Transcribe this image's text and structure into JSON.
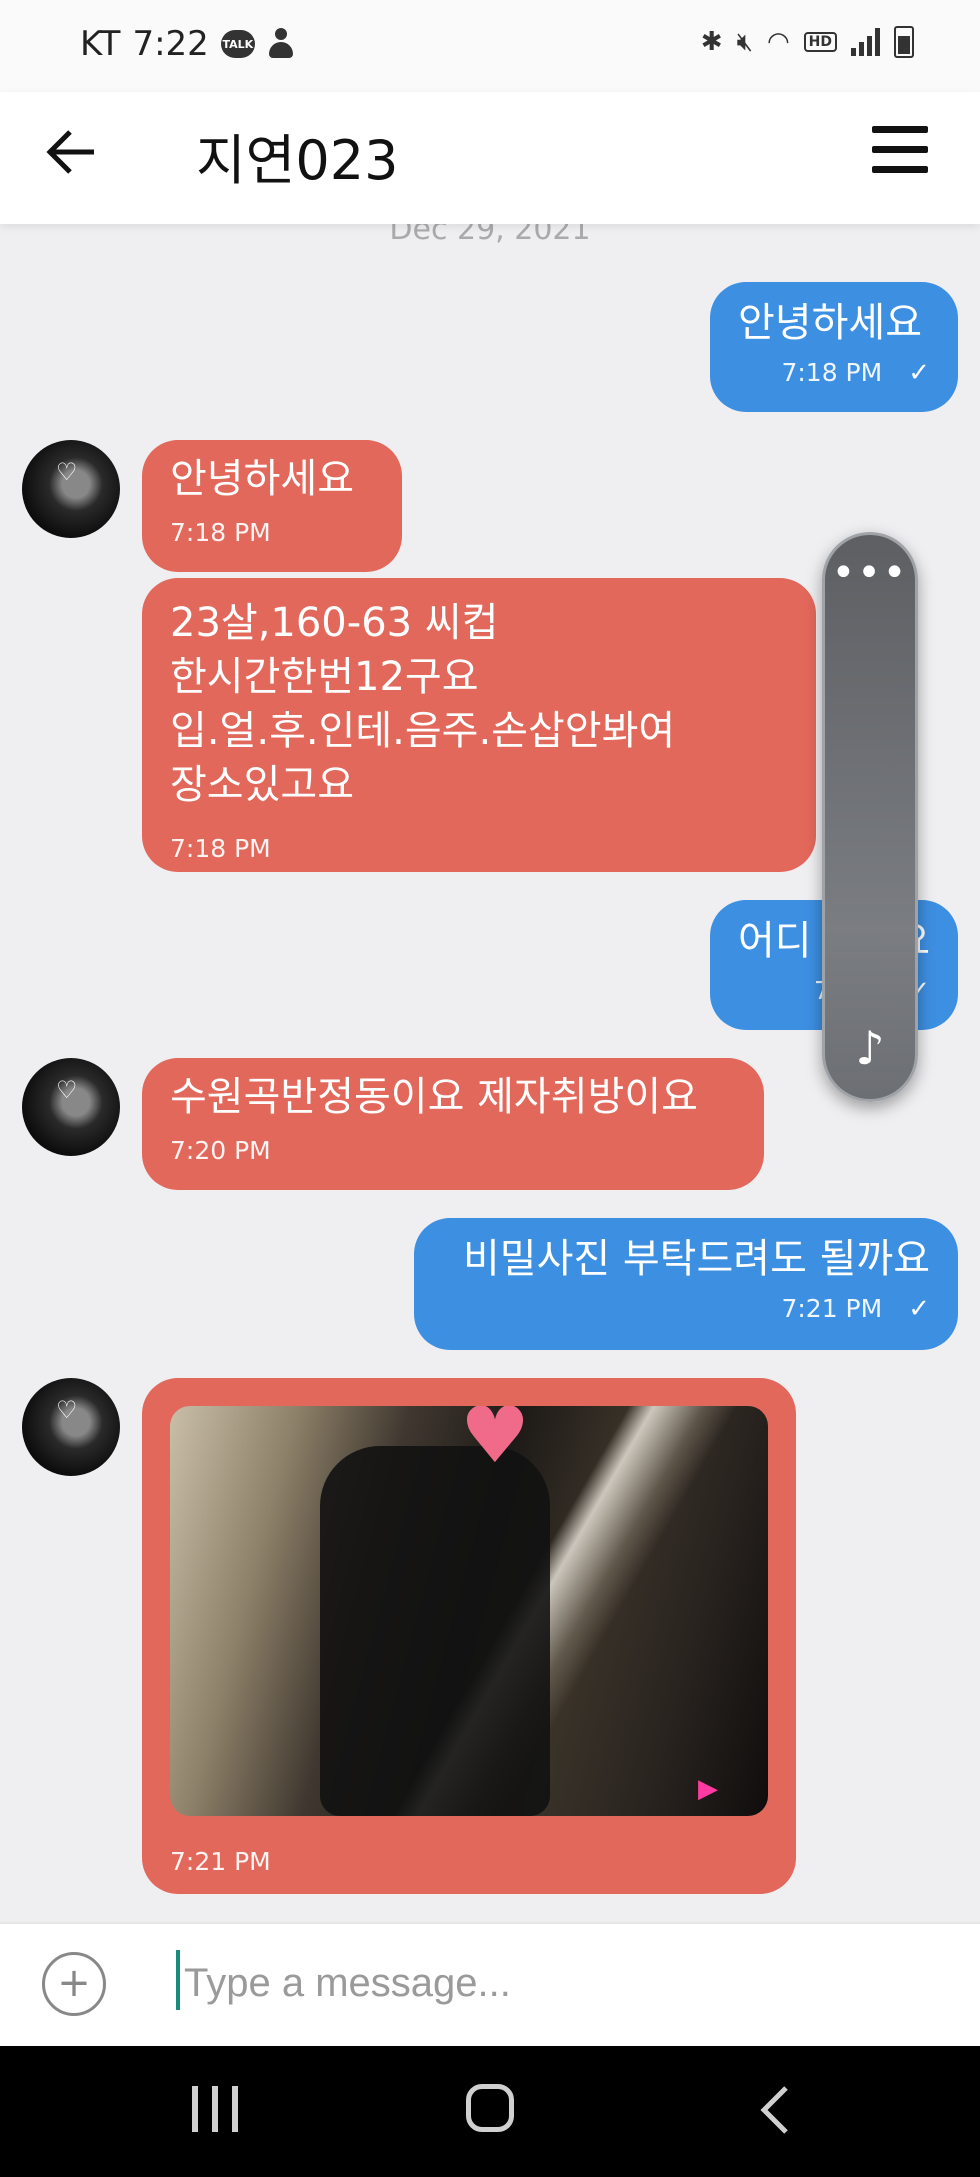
{
  "status_bar": {
    "carrier": "KT",
    "time": "7:22",
    "talk_badge": "TALK",
    "icons": [
      "bluetooth-icon",
      "mute-icon",
      "wifi-icon",
      "hd-icon",
      "signal-icon",
      "battery-icon"
    ],
    "hd_label": "HD"
  },
  "header": {
    "title": "지연023",
    "back_icon": "arrow-left-icon",
    "menu_icon": "hamburger-menu-icon"
  },
  "date_separator": "Dec 29, 2021",
  "messages": [
    {
      "direction": "out",
      "text": "안녕하세요",
      "time": "7:18 PM",
      "status": "✓"
    },
    {
      "direction": "in",
      "text": "안녕하세요",
      "time": "7:18 PM"
    },
    {
      "direction": "in",
      "text": "23살,160-63 씨컵\n한시간한번12구요\n입.얼.후.인테.음주.손삽안봐여\n장소있고요",
      "time": "7:18 PM"
    },
    {
      "direction": "out",
      "text": "어디신가요",
      "text_visible": "어디",
      "text_visible_end": "요",
      "time": "7:1",
      "status": "✓"
    },
    {
      "direction": "in",
      "text": "수원곡반정동이요 제자취방이요",
      "time": "7:20 PM"
    },
    {
      "direction": "out",
      "text": "비밀사진 부탁드려도 될까요",
      "time": "7:21 PM",
      "status": "✓"
    },
    {
      "direction": "in",
      "type": "image",
      "time": "7:21 PM"
    }
  ],
  "floating_widget": {
    "top_icon": "more-dots-icon",
    "top_glyph": "•••",
    "bottom_icon": "music-note-icon",
    "bottom_glyph": "♪"
  },
  "input": {
    "placeholder": "Type a message...",
    "value": "",
    "add_glyph": "+"
  },
  "colors": {
    "outgoing": "#3d8fe2",
    "incoming": "#e2685b",
    "background": "#efeff1"
  }
}
